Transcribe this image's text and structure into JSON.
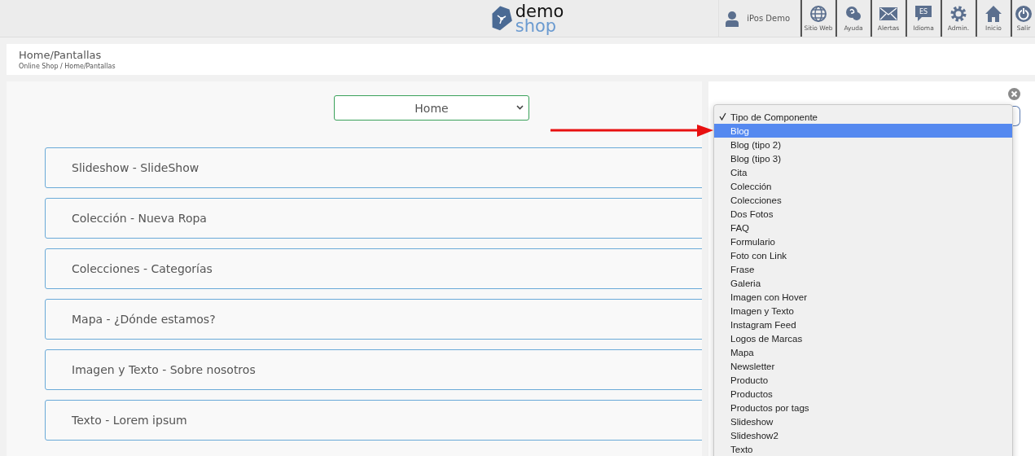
{
  "header": {
    "logo": {
      "line1": "demo",
      "line2": "shop"
    },
    "user": "iPos Demo",
    "nav": [
      {
        "kind": "web",
        "label": "Sitio Web"
      },
      {
        "kind": "help",
        "label": "Ayuda"
      },
      {
        "kind": "mail",
        "label": "Alertas"
      },
      {
        "kind": "lang",
        "label": "Idioma",
        "badge": "ES"
      },
      {
        "kind": "gear",
        "label": "Admin."
      },
      {
        "kind": "home",
        "label": "Inicio"
      },
      {
        "kind": "power",
        "label": "Salir"
      }
    ]
  },
  "page_header": {
    "title": "Home/Pantallas",
    "breadcrumb": "Online Shop / Home/Pantallas"
  },
  "screen_select": {
    "value": "Home"
  },
  "components": [
    {
      "title": "Slideshow - SlideShow"
    },
    {
      "title": "Colección - Nueva Ropa"
    },
    {
      "title": "Colecciones - Categorías"
    },
    {
      "title": "Mapa - ¿Dónde estamos?"
    },
    {
      "title": "Imagen y Texto - Sobre nosotros"
    },
    {
      "title": "Texto - Lorem ipsum"
    }
  ],
  "component_type_menu": {
    "items": [
      {
        "label": "Tipo de Componente",
        "checked": true,
        "selected": false
      },
      {
        "label": "Blog",
        "checked": false,
        "selected": true
      },
      {
        "label": "Blog (tipo 2)",
        "checked": false,
        "selected": false
      },
      {
        "label": "Blog (tipo 3)",
        "checked": false,
        "selected": false
      },
      {
        "label": "Cita",
        "checked": false,
        "selected": false
      },
      {
        "label": "Colección",
        "checked": false,
        "selected": false
      },
      {
        "label": "Colecciones",
        "checked": false,
        "selected": false
      },
      {
        "label": "Dos Fotos",
        "checked": false,
        "selected": false
      },
      {
        "label": "FAQ",
        "checked": false,
        "selected": false
      },
      {
        "label": "Formulario",
        "checked": false,
        "selected": false
      },
      {
        "label": "Foto con Link",
        "checked": false,
        "selected": false
      },
      {
        "label": "Frase",
        "checked": false,
        "selected": false
      },
      {
        "label": "Galeria",
        "checked": false,
        "selected": false
      },
      {
        "label": "Imagen con Hover",
        "checked": false,
        "selected": false
      },
      {
        "label": "Imagen y Texto",
        "checked": false,
        "selected": false
      },
      {
        "label": "Instagram Feed",
        "checked": false,
        "selected": false
      },
      {
        "label": "Logos de Marcas",
        "checked": false,
        "selected": false
      },
      {
        "label": "Mapa",
        "checked": false,
        "selected": false
      },
      {
        "label": "Newsletter",
        "checked": false,
        "selected": false
      },
      {
        "label": "Producto",
        "checked": false,
        "selected": false
      },
      {
        "label": "Productos",
        "checked": false,
        "selected": false
      },
      {
        "label": "Productos por tags",
        "checked": false,
        "selected": false
      },
      {
        "label": "Slideshow",
        "checked": false,
        "selected": false
      },
      {
        "label": "Slideshow2",
        "checked": false,
        "selected": false
      },
      {
        "label": "Texto",
        "checked": false,
        "selected": false
      }
    ]
  }
}
